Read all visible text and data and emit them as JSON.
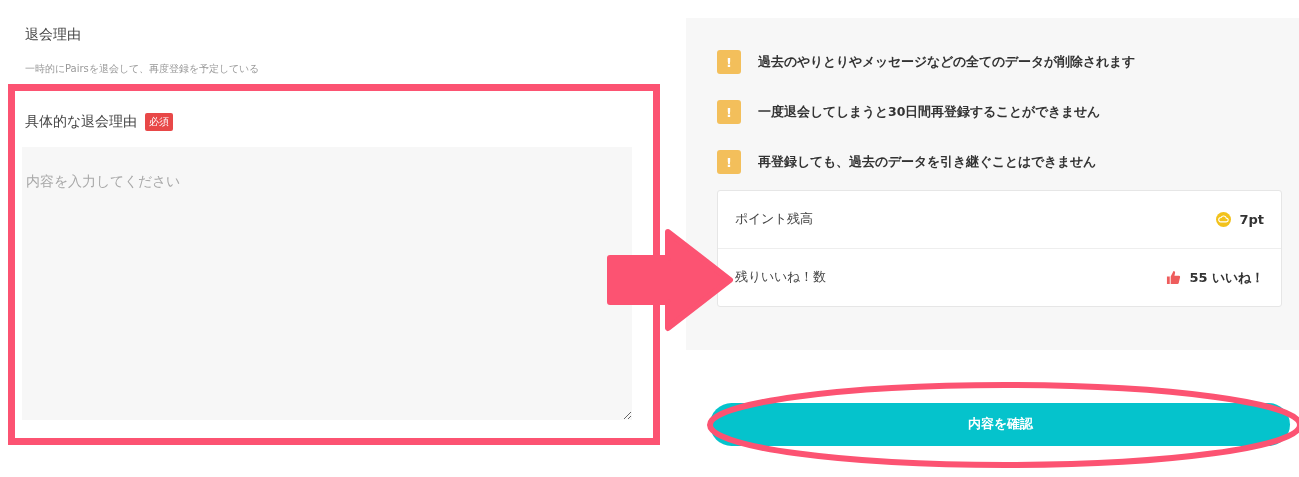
{
  "reason": {
    "title": "退会理由",
    "value": "一時的にPairsを退会して、再度登録を予定している"
  },
  "detail": {
    "label": "具体的な退会理由",
    "badge": "必須",
    "placeholder": "内容を入力してください"
  },
  "warnings": [
    {
      "icon": "!",
      "text": "過去のやりとりやメッセージなどの全てのデータが削除されます"
    },
    {
      "icon": "!",
      "text": "一度退会してしまうと30日間再登録することができません"
    },
    {
      "icon": "!",
      "text": "再登録しても、過去のデータを引き継ぐことはできません"
    }
  ],
  "balances": [
    {
      "kind": "points",
      "label": "ポイント残高",
      "value": "7pt"
    },
    {
      "kind": "likes",
      "label": "残りいいね！数",
      "value": "55 いいね！"
    }
  ],
  "confirm_button": "内容を確認"
}
